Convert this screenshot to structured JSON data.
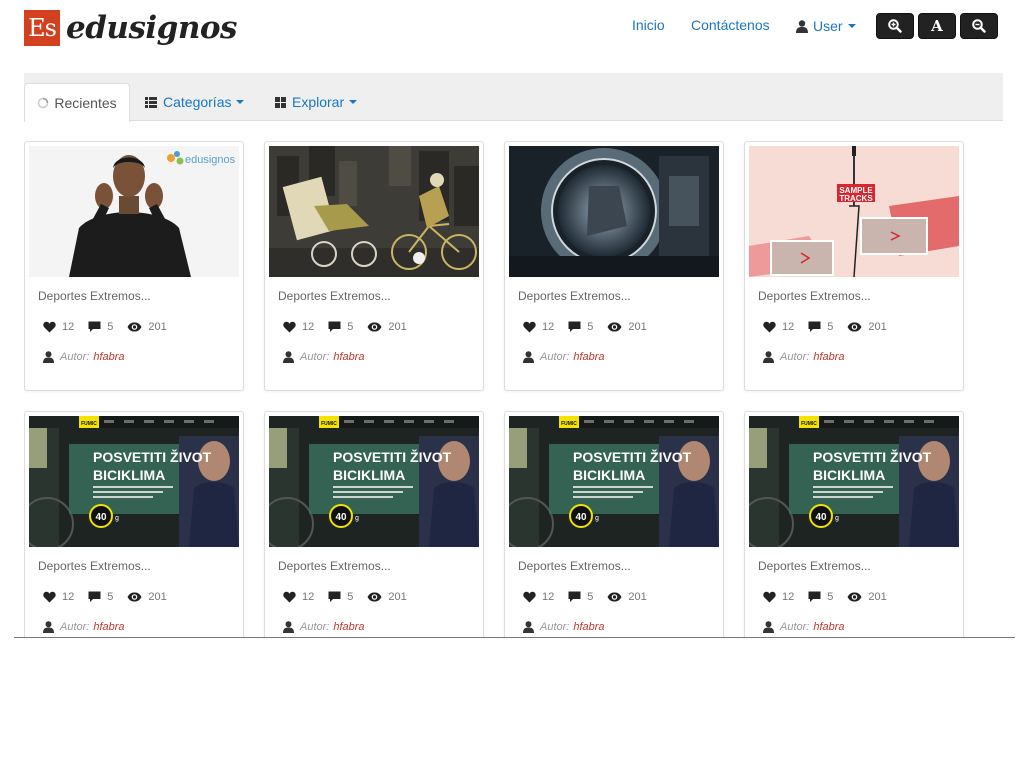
{
  "brand": {
    "mark": "Es",
    "name": "edusignos"
  },
  "nav": {
    "inicio": "Inicio",
    "contacto": "Contáctenos",
    "user": "User"
  },
  "tools": [
    {
      "icon": "zoom-in-icon"
    },
    {
      "icon": "font-size-icon",
      "label": "A"
    },
    {
      "icon": "zoom-out-icon"
    }
  ],
  "tabs": {
    "recientes": "Recientes",
    "categorias": "Categorías",
    "explorar": "Explorar"
  },
  "cards": [
    {
      "thumb": "signer",
      "title": "Deportes Extremos...",
      "likes": "12",
      "comments": "5",
      "views": "201",
      "author_label": "Autor:",
      "author": "hfabra"
    },
    {
      "thumb": "bike-art",
      "title": "Deportes Extremos...",
      "likes": "12",
      "comments": "5",
      "views": "201",
      "author_label": "Autor:",
      "author": "hfabra"
    },
    {
      "thumb": "robot",
      "title": "Deportes Extremos...",
      "likes": "12",
      "comments": "5",
      "views": "201",
      "author_label": "Autor:",
      "author": "hfabra"
    },
    {
      "thumb": "sample-tracks",
      "title": "Deportes Extremos...",
      "likes": "12",
      "comments": "5",
      "views": "201",
      "author_label": "Autor:",
      "author": "hfabra"
    },
    {
      "thumb": "bicycle-web",
      "title": "Deportes Extremos...",
      "likes": "12",
      "comments": "5",
      "views": "201",
      "author_label": "Autor:",
      "author": "hfabra"
    },
    {
      "thumb": "bicycle-web",
      "title": "Deportes Extremos...",
      "likes": "12",
      "comments": "5",
      "views": "201",
      "author_label": "Autor:",
      "author": "hfabra"
    },
    {
      "thumb": "bicycle-web",
      "title": "Deportes Extremos...",
      "likes": "12",
      "comments": "5",
      "views": "201",
      "author_label": "Autor:",
      "author": "hfabra"
    },
    {
      "thumb": "bicycle-web",
      "title": "Deportes Extremos...",
      "likes": "12",
      "comments": "5",
      "views": "201",
      "author_label": "Autor:",
      "author": "hfabra"
    }
  ],
  "thumb_text": {
    "signer_logo": "edusignos",
    "sample_tracks_line1": "SAMPLE",
    "sample_tracks_line2": "TRACKS",
    "bike_tag": "FUMIC",
    "bike_line1": "POSVETITI ŽIVOT",
    "bike_line2": "BICIKLIMA",
    "bike_badge": "40",
    "bike_badge_unit": "g"
  },
  "colors": {
    "link": "#1a76c4",
    "brand": "#d2401f",
    "author": "#c0392b"
  }
}
